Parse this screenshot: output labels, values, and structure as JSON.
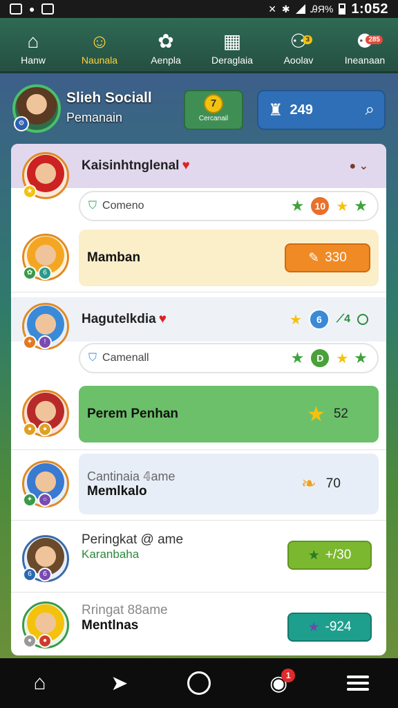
{
  "status": {
    "time": "1:052",
    "percent": "ᎯЯ%"
  },
  "top_nav": [
    {
      "label": "Hanw",
      "icon": "home-icon",
      "glyph": "⌂"
    },
    {
      "label": "Naunala",
      "icon": "avatar-icon",
      "glyph": "☺",
      "active": true
    },
    {
      "label": "Aenpla",
      "icon": "group-icon",
      "glyph": "✿"
    },
    {
      "label": "Deraglaia",
      "icon": "calendar-icon",
      "glyph": "▦"
    },
    {
      "label": "Aoolav",
      "icon": "friends-icon",
      "glyph": "⚇",
      "badge": "3"
    },
    {
      "label": "Ineanaan",
      "icon": "community-icon",
      "glyph": "⚉",
      "badge": "285"
    }
  ],
  "profile": {
    "name": "Sliеh Sociall",
    "subtitle": "Pemanain",
    "coin_value": "7",
    "coin_label": "Cercanail",
    "score": "249"
  },
  "rows": {
    "r1": {
      "name": "Kaisinhtnglenal",
      "pill_text": "Comeno",
      "badge": "10"
    },
    "r1_card": {
      "label": "Mamban",
      "score": "330"
    },
    "r2": {
      "name": "Hagutelkdia",
      "pill_text": "Camenall",
      "badge": "D"
    },
    "r2_card": {
      "label": "Perem Penhan",
      "score": "52"
    },
    "r3": {
      "title": "Cantinaia 𝟜ame",
      "label": "Memlkalo",
      "score": "70"
    },
    "r4": {
      "title": "Peringkat @ ame",
      "sub": "Karanbaha",
      "score": "+/30"
    },
    "r5": {
      "title": "Rringat 88ame",
      "label": "Mentlnas",
      "score": "-924"
    }
  },
  "bottom": {
    "notif_badge": "1"
  },
  "colors": {
    "orange": "#f08a24",
    "green_card": "#6cc06a",
    "lime": "#7cb82f",
    "teal": "#1e9f8e",
    "cream": "#fbefc9"
  }
}
